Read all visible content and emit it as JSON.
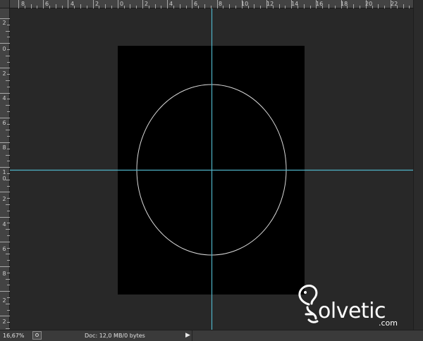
{
  "ruler_top": {
    "labels": [
      "8",
      "6",
      "4",
      "2",
      "0",
      "2",
      "4",
      "6",
      "8",
      "10",
      "12",
      "14",
      "16",
      "18",
      "20",
      "22"
    ]
  },
  "ruler_left": {
    "labels": [
      "2",
      "0",
      "2",
      "4",
      "6",
      "8",
      "1",
      "0",
      "2",
      "4",
      "6",
      "8",
      "2",
      "2"
    ]
  },
  "canvas": {
    "background": "#282828",
    "document_color": "#000000",
    "guide_color": "#4fb3c7",
    "selection_stroke": "#d8d8d8",
    "shape": "ellipse selection"
  },
  "status": {
    "zoom": "16,67%",
    "doc_info": "Doc: 12,0 MB/0 bytes",
    "arrow": "▶"
  },
  "watermark": {
    "brand": "olvetic",
    "domain": ".com"
  }
}
